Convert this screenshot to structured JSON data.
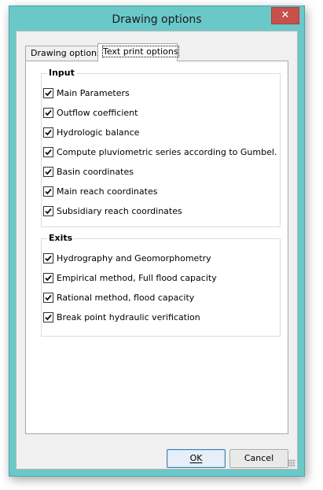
{
  "window": {
    "title": "Drawing options",
    "close_glyph": "✕"
  },
  "tabs": [
    {
      "label": "Drawing options",
      "selected": false
    },
    {
      "label": "Text print options",
      "selected": true
    }
  ],
  "groups": {
    "input": {
      "legend": "Input",
      "items": [
        {
          "label": "Main Parameters",
          "checked": true
        },
        {
          "label": "Outflow coefficient",
          "checked": true
        },
        {
          "label": "Hydrologic balance",
          "checked": true
        },
        {
          "label": "Compute pluviometric series according to Gumbel.",
          "checked": true
        },
        {
          "label": "Basin coordinates",
          "checked": true
        },
        {
          "label": "Main reach coordinates",
          "checked": true
        },
        {
          "label": "Subsidiary reach coordinates",
          "checked": true
        }
      ]
    },
    "exits": {
      "legend": "Exits",
      "items": [
        {
          "label": "Hydrography and Geomorphometry",
          "checked": true
        },
        {
          "label": "Empirical method, Full flood capacity",
          "checked": true
        },
        {
          "label": "Rational method, flood capacity",
          "checked": true
        },
        {
          "label": "Break point hydraulic verification",
          "checked": true
        }
      ]
    }
  },
  "buttons": {
    "ok": "OK",
    "cancel": "Cancel"
  },
  "colors": {
    "frame": "#6ac8c8",
    "close": "#c7504b"
  },
  "icons": {
    "check": "checkmark-icon",
    "close": "close-icon"
  }
}
